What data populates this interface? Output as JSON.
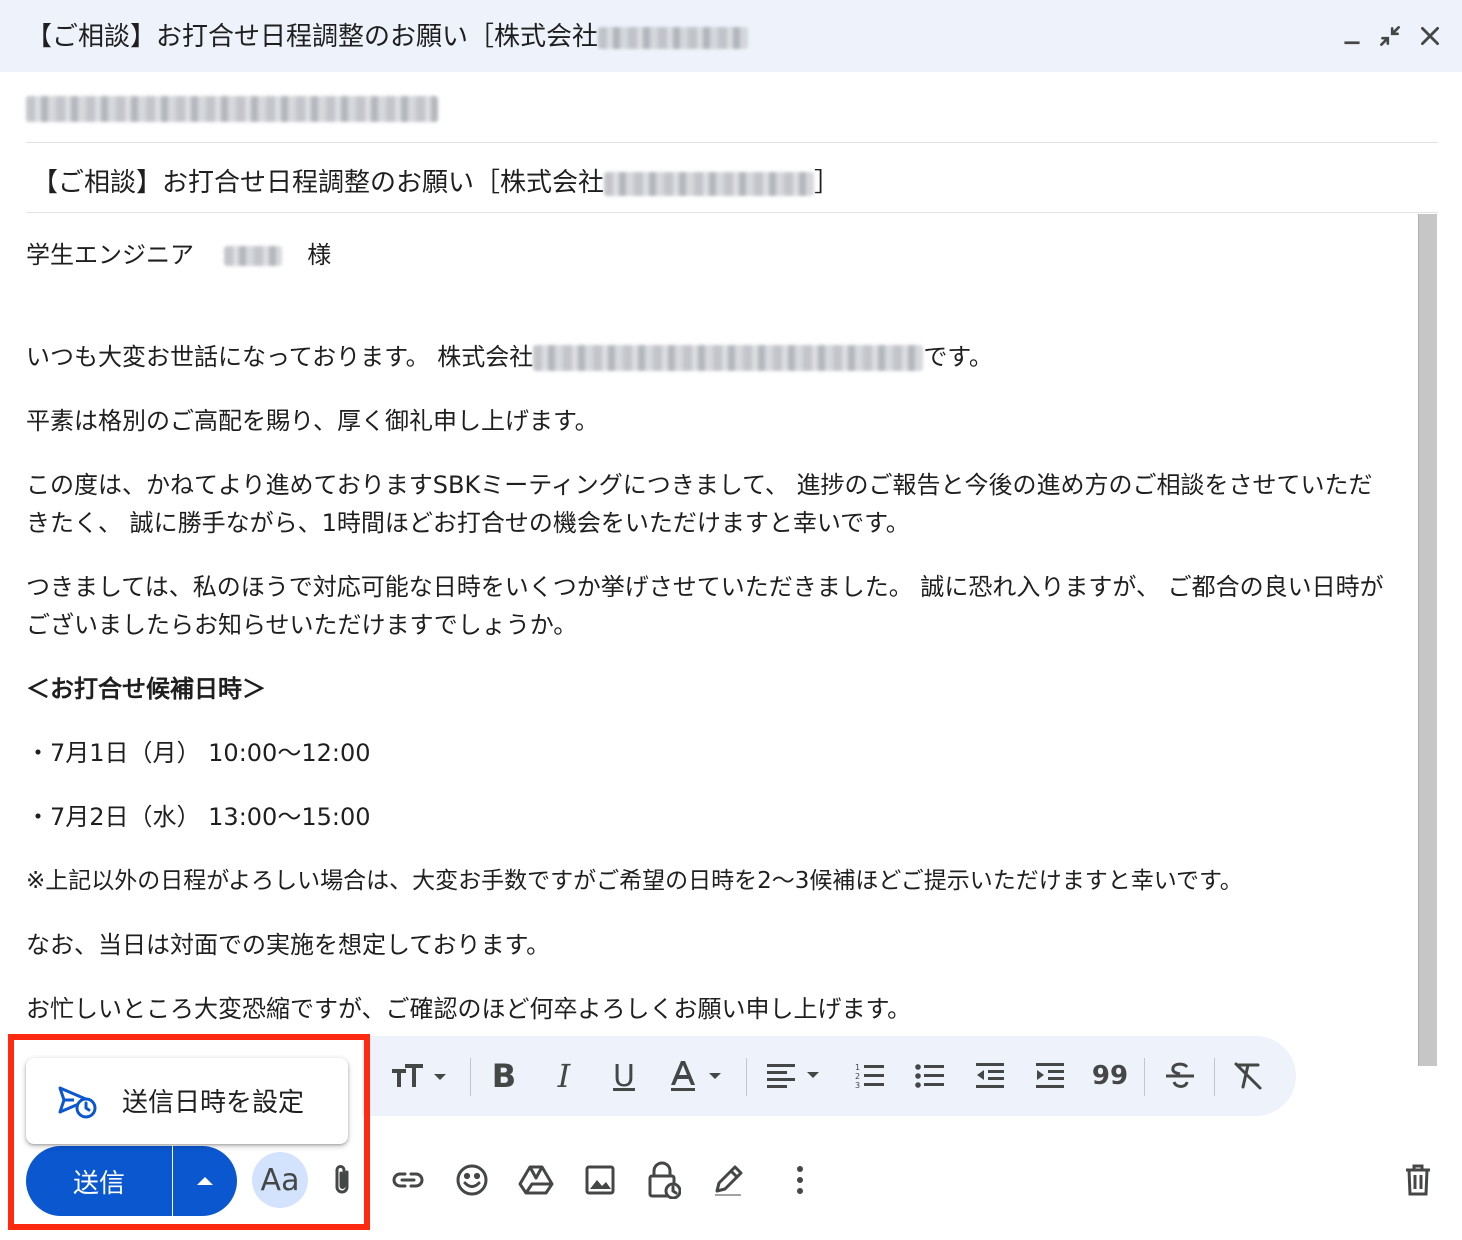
{
  "window": {
    "title": "【ご相談】お打合せ日程調整のお願い［株式会社",
    "controls": [
      "minimize-icon",
      "exit-fullscreen-icon",
      "close-icon"
    ]
  },
  "subject": {
    "prefix": "【ご相談】お打合せ日程調整のお願い［株式会社",
    "suffix": "］"
  },
  "body": {
    "greeting": "学生エンジニア",
    "greeting_suffix": "様",
    "p1_a": "いつも大変お世話になっております。 株式会社",
    "p1_b": "です。",
    "p2": "平素は格別のご高配を賜り、厚く御礼申し上げます。",
    "p3": "この度は、かねてより進めておりますSBKミーティングにつきまして、 進捗のご報告と今後の進め方のご相談をさせていただきたく、 誠に勝手ながら、1時間ほどお打合せの機会をいただけますと幸いです。",
    "p4": "つきましては、私のほうで対応可能な日時をいくつか挙げさせていただきました。 誠に恐れ入りますが、 ご都合の良い日時がございましたらお知らせいただけますでしょうか。",
    "heading": "＜お打合せ候補日時＞",
    "slot1": "・7月1日（月） 10:00〜12:00",
    "slot2": "・7月2日（水） 13:00〜15:00",
    "note": "※上記以外の日程がよろしい場合は、大変お手数ですがご希望の日時を2〜3候補ほどご提示いただけますと幸いです。",
    "p5": "なお、当日は対面での実施を想定しております。",
    "p6": "お忙しいところ大変恐縮ですが、ご確認のほど何卒よろしくお願い申し上げます。"
  },
  "compose": {
    "send_label": "送信",
    "schedule_label": "送信日時を設定",
    "format_label": "Aa"
  },
  "colors": {
    "accent": "#0b57d0",
    "highlight": "#ff2a10",
    "titlebar_bg": "#eef2fa"
  }
}
